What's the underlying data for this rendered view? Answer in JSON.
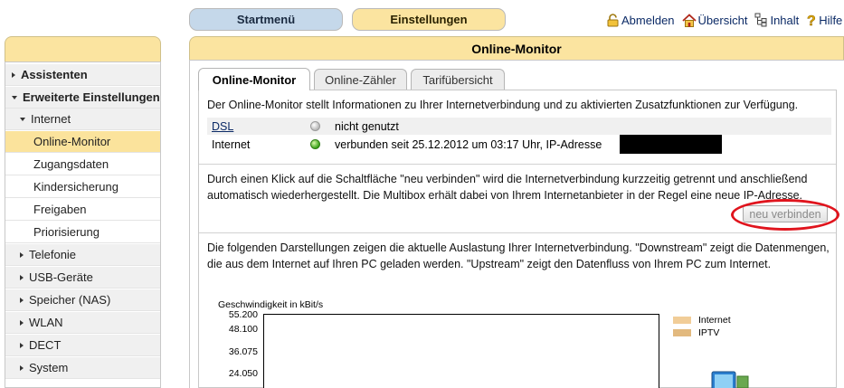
{
  "nav_top": {
    "start_label": "Startmenü",
    "settings_label": "Einstellungen",
    "links": [
      {
        "label": "Abmelden",
        "icon": "lock-icon"
      },
      {
        "label": "Übersicht",
        "icon": "home-icon"
      },
      {
        "label": "Inhalt",
        "icon": "sitemap-icon"
      },
      {
        "label": "Hilfe",
        "icon": "help-icon"
      }
    ]
  },
  "sidebar": {
    "items": [
      {
        "label": "Assistenten",
        "level": 0,
        "expanded": false
      },
      {
        "label": "Erweiterte Einstellungen",
        "level": 0,
        "expanded": true
      },
      {
        "label": "Internet",
        "level": 1,
        "expanded": true
      },
      {
        "label": "Online-Monitor",
        "level": 2,
        "active": true
      },
      {
        "label": "Zugangsdaten",
        "level": 2
      },
      {
        "label": "Kindersicherung",
        "level": 2
      },
      {
        "label": "Freigaben",
        "level": 2
      },
      {
        "label": "Priorisierung",
        "level": 2
      },
      {
        "label": "Telefonie",
        "level": 1,
        "expanded": false
      },
      {
        "label": "USB-Geräte",
        "level": 1,
        "expanded": false
      },
      {
        "label": "Speicher (NAS)",
        "level": 1,
        "expanded": false
      },
      {
        "label": "WLAN",
        "level": 1,
        "expanded": false
      },
      {
        "label": "DECT",
        "level": 1,
        "expanded": false
      },
      {
        "label": "System",
        "level": 1,
        "expanded": false
      }
    ]
  },
  "main": {
    "title": "Online-Monitor",
    "tabs": [
      {
        "label": "Online-Monitor",
        "active": true
      },
      {
        "label": "Online-Zähler",
        "active": false
      },
      {
        "label": "Tarifübersicht",
        "active": false
      }
    ],
    "intro": "Der Online-Monitor stellt Informationen zu Ihrer Internetverbindung und zu aktivierten Zusatzfunktionen zur Verfügung.",
    "status": [
      {
        "name": "DSL",
        "led": "grey",
        "text": "nicht genutzt"
      },
      {
        "name": "Internet",
        "led": "green",
        "text": "verbunden seit 25.12.2012 um 03:17 Uhr, IP-Adresse"
      }
    ],
    "reconnect_text": "Durch einen Klick auf die Schaltfläche \"neu verbinden\" wird die Internetverbindung kurzzeitig getrennt und anschließend automatisch wiederhergestellt. Die Multibox erhält dabei von Ihrem Internetanbieter in der Regel eine neue IP-Adresse.",
    "reconnect_button": "neu verbinden",
    "usage_text": "Die folgenden Darstellungen zeigen die aktuelle Auslastung Ihrer Internetverbindung. \"Downstream\" zeigt die Datenmengen, die aus dem Internet auf Ihren PC geladen werden. \"Upstream\" zeigt den Datenfluss von Ihrem PC zum Internet."
  },
  "chart": {
    "title": "Geschwindigkeit in kBit/s",
    "y_ticks": [
      "55.200",
      "48.100",
      "36.075",
      "24.050"
    ],
    "legend": [
      {
        "label": "Internet",
        "color": "#f1cd98"
      },
      {
        "label": "IPTV",
        "color": "#e2b97e"
      }
    ]
  },
  "colors": {
    "accent_yellow": "#fbe4a0",
    "start_blue": "#c5d8ea",
    "highlight_red": "#e0141d"
  }
}
